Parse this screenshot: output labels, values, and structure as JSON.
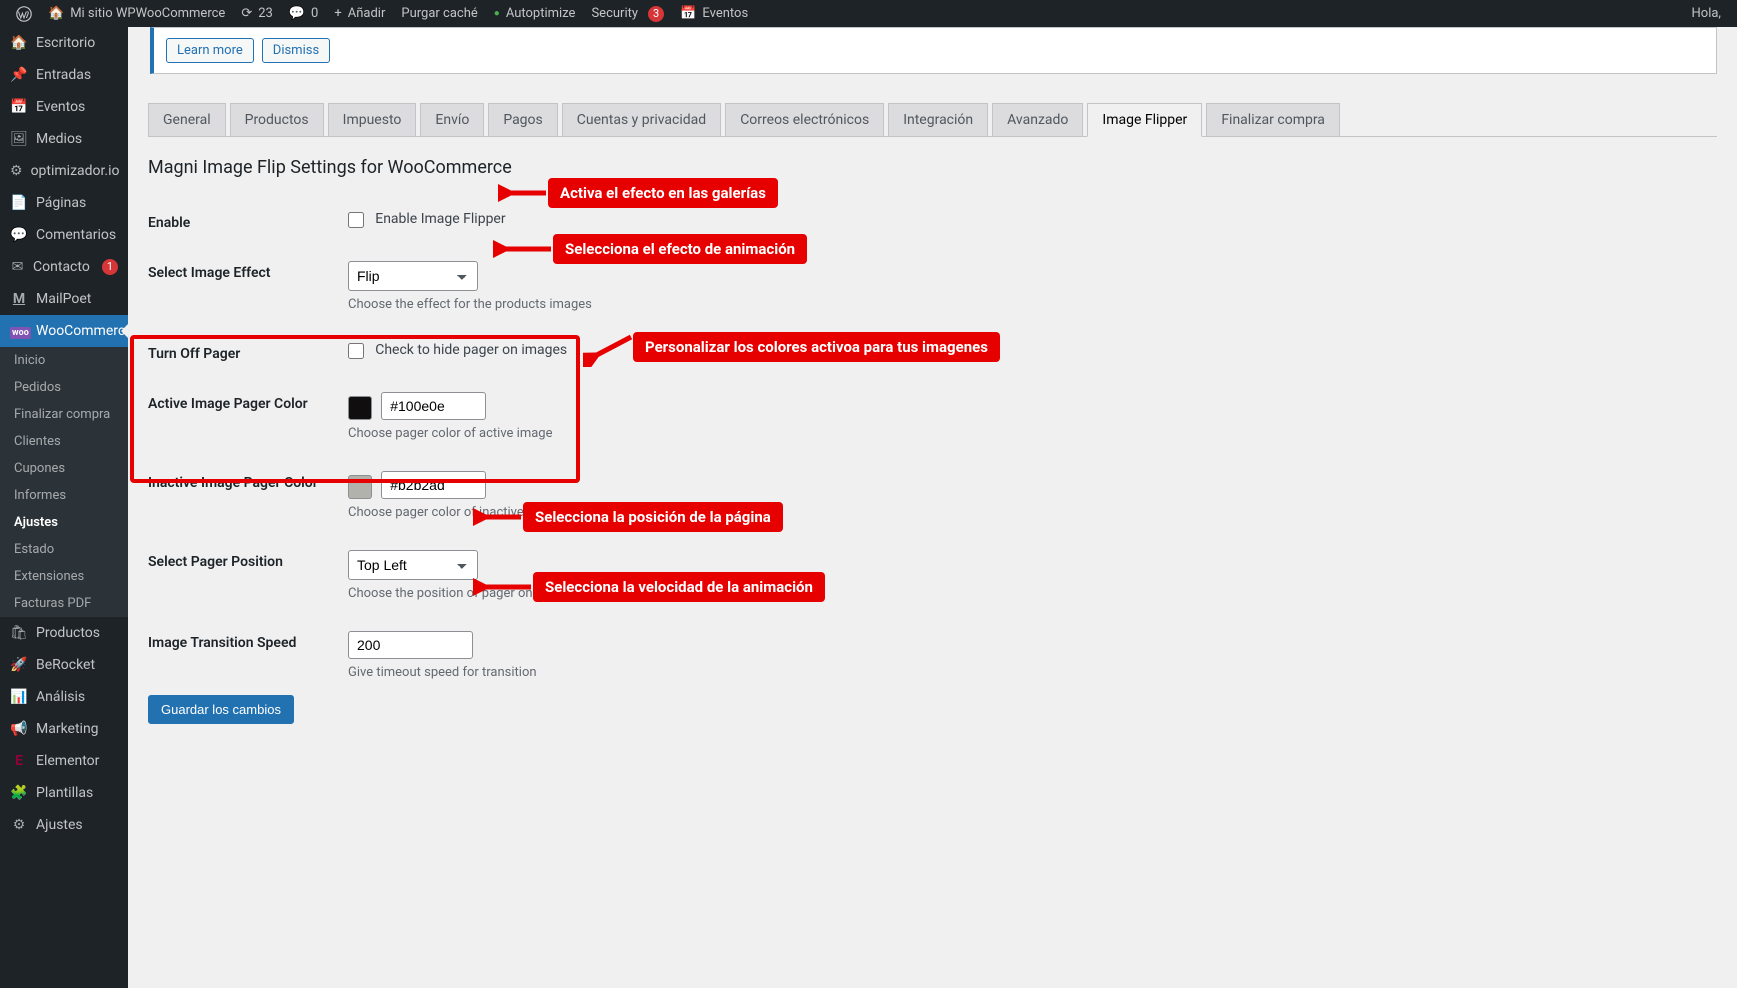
{
  "adminbar": {
    "site": "Mi sitio WPWooCommerce",
    "updates": "23",
    "comments": "0",
    "add": "Añadir",
    "purge": "Purgar caché",
    "autoptimize": "Autoptimize",
    "security": "Security",
    "security_badge": "3",
    "events": "Eventos",
    "greeting": "Hola,"
  },
  "menu": {
    "items": [
      {
        "icon": "🏠",
        "label": "Escritorio"
      },
      {
        "icon": "📌",
        "label": "Entradas"
      },
      {
        "icon": "📅",
        "label": "Eventos"
      },
      {
        "icon": "🖼",
        "label": "Medios"
      },
      {
        "icon": "⚙",
        "label": "optimizador.io"
      },
      {
        "icon": "📄",
        "label": "Páginas"
      },
      {
        "icon": "💬",
        "label": "Comentarios"
      },
      {
        "icon": "✉",
        "label": "Contacto",
        "badge": "1"
      },
      {
        "icon": "M",
        "label": "MailPoet"
      },
      {
        "icon": "woo",
        "label": "WooCommerce",
        "active": true
      }
    ],
    "submenu": [
      "Inicio",
      "Pedidos",
      "Finalizar compra",
      "Clientes",
      "Cupones",
      "Informes",
      "Ajustes",
      "Estado",
      "Extensiones",
      "Facturas PDF"
    ],
    "submenu_current": "Ajustes",
    "items2": [
      {
        "icon": "🛍",
        "label": "Productos"
      },
      {
        "icon": "🚀",
        "label": "BeRocket"
      },
      {
        "icon": "📊",
        "label": "Análisis"
      },
      {
        "icon": "📢",
        "label": "Marketing"
      },
      {
        "icon": "E",
        "label": "Elementor"
      },
      {
        "icon": "🧩",
        "label": "Plantillas"
      },
      {
        "icon": "⚙",
        "label": "Ajustes"
      }
    ]
  },
  "notice": {
    "learn": "Learn more",
    "dismiss": "Dismiss"
  },
  "tabs": [
    "General",
    "Productos",
    "Impuesto",
    "Envío",
    "Pagos",
    "Cuentas y privacidad",
    "Correos electrónicos",
    "Integración",
    "Avanzado",
    "Image Flipper",
    "Finalizar compra"
  ],
  "tab_active": "Image Flipper",
  "section_title": "Magni Image Flip Settings for WooCommerce",
  "form": {
    "enable_label": "Enable",
    "enable_cb": "Enable Image Flipper",
    "effect_label": "Select Image Effect",
    "effect_value": "Flip",
    "effect_desc": "Choose the effect for the products images",
    "pager_label": "Turn Off Pager",
    "pager_cb": "Check to hide pager on images",
    "active_color_label": "Active Image Pager Color",
    "active_color_value": "#100e0e",
    "active_color_swatch": "#100e0e",
    "active_color_desc": "Choose pager color of active image",
    "inactive_color_label": "Inactive Image Pager Color",
    "inactive_color_value": "#b2b2ad",
    "inactive_color_swatch": "#b2b2ad",
    "inactive_color_desc": "Choose pager color of inactive image",
    "position_label": "Select Pager Position",
    "position_value": "Top Left",
    "position_desc": "Choose the position of pager on image",
    "speed_label": "Image Transition Speed",
    "speed_value": "200",
    "speed_desc": "Give timeout speed for transition",
    "save": "Guardar los cambios"
  },
  "callouts": {
    "c1": "Activa el efecto en las galerías",
    "c2": "Selecciona el efecto de animación",
    "c3": "Personalizar los colores activoa para tus imagenes",
    "c4": "Selecciona la posición de la página",
    "c5": "Selecciona la velocidad de la animación"
  }
}
